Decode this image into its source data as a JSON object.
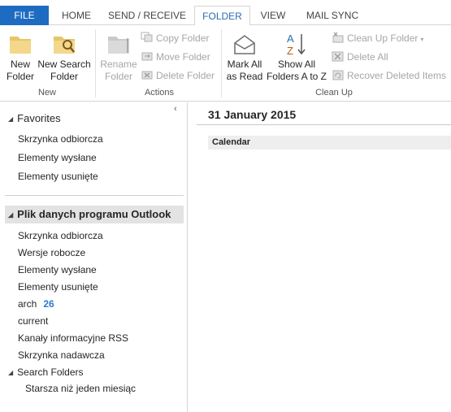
{
  "ribbon_tabs": {
    "file": "FILE",
    "home": "HOME",
    "send_receive": "SEND / RECEIVE",
    "folder": "FOLDER",
    "view": "VIEW",
    "mail_sync": "MAIL SYNC"
  },
  "groups": {
    "new": {
      "label": "New",
      "new_folder": "New\nFolder",
      "new_search_folder": "New Search\nFolder"
    },
    "actions": {
      "label": "Actions",
      "rename_folder": "Rename\nFolder",
      "copy_folder": "Copy Folder",
      "move_folder": "Move Folder",
      "delete_folder": "Delete Folder"
    },
    "clean_up": {
      "label": "Clean Up",
      "mark_all_as_read": "Mark All\nas Read",
      "show_all_folders": "Show All\nFolders A to Z",
      "clean_up_folder": "Clean Up Folder",
      "delete_all": "Delete All",
      "recover_deleted_items": "Recover Deleted Items"
    }
  },
  "folder_pane": {
    "collapse_glyph": "‹",
    "favorites_header": "Favorites",
    "favorites": [
      "Skrzynka odbiorcza",
      "Elementy wysłane",
      "Elementy usunięte"
    ],
    "store_header": "Plik danych programu Outlook",
    "folders": [
      {
        "name": "Skrzynka odbiorcza"
      },
      {
        "name": "Wersje robocze"
      },
      {
        "name": "Elementy wysłane"
      },
      {
        "name": "Elementy usunięte"
      },
      {
        "name": "arch",
        "unread": "26"
      },
      {
        "name": "current"
      },
      {
        "name": "Kanały informacyjne RSS"
      },
      {
        "name": "Skrzynka nadawcza"
      }
    ],
    "search_folders_header": "Search Folders",
    "search_folders": [
      "Starsza niż jeden miesiąc"
    ]
  },
  "main": {
    "date_title": "31 January 2015",
    "calendar_label": "Calendar"
  },
  "colors": {
    "file_tab_bg": "#1e6cc1",
    "accent_text": "#2b6cb4",
    "unread_count": "#2b7ad1",
    "store_header_bg": "#e3e3e3"
  }
}
